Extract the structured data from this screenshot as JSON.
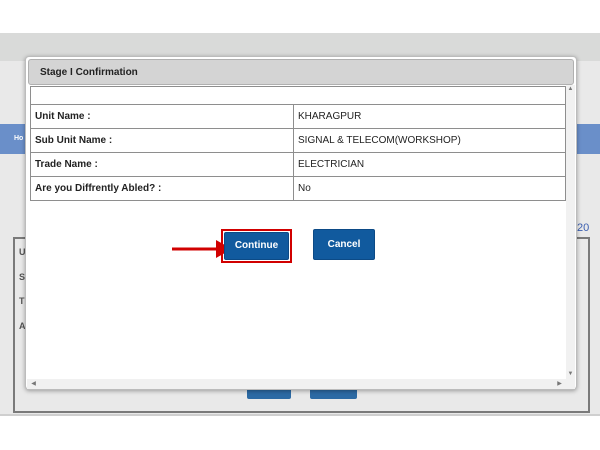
{
  "background": {
    "nav_label": "Ho",
    "peek_number": "20",
    "labels": [
      "U",
      "S",
      "Ti",
      "A"
    ]
  },
  "modal": {
    "title": "Stage I Confirmation",
    "rows": [
      {
        "label": "Unit Name :",
        "value": "KHARAGPUR"
      },
      {
        "label": "Sub Unit Name :",
        "value": "SIGNAL & TELECOM(WORKSHOP)"
      },
      {
        "label": "Trade Name :",
        "value": "ELECTRICIAN"
      },
      {
        "label": "Are you Diffrently Abled? :",
        "value": "No"
      }
    ],
    "continue_label": "Continue",
    "cancel_label": "Cancel"
  },
  "colors": {
    "button": "#115a9e",
    "highlight": "#d10000",
    "nav": "#6a8fc9"
  },
  "icons": {
    "annotation_arrow": "red-arrow-icon",
    "scroll_up": "triangle-up",
    "scroll_down": "triangle-down",
    "scroll_left": "triangle-left",
    "scroll_right": "triangle-right"
  }
}
